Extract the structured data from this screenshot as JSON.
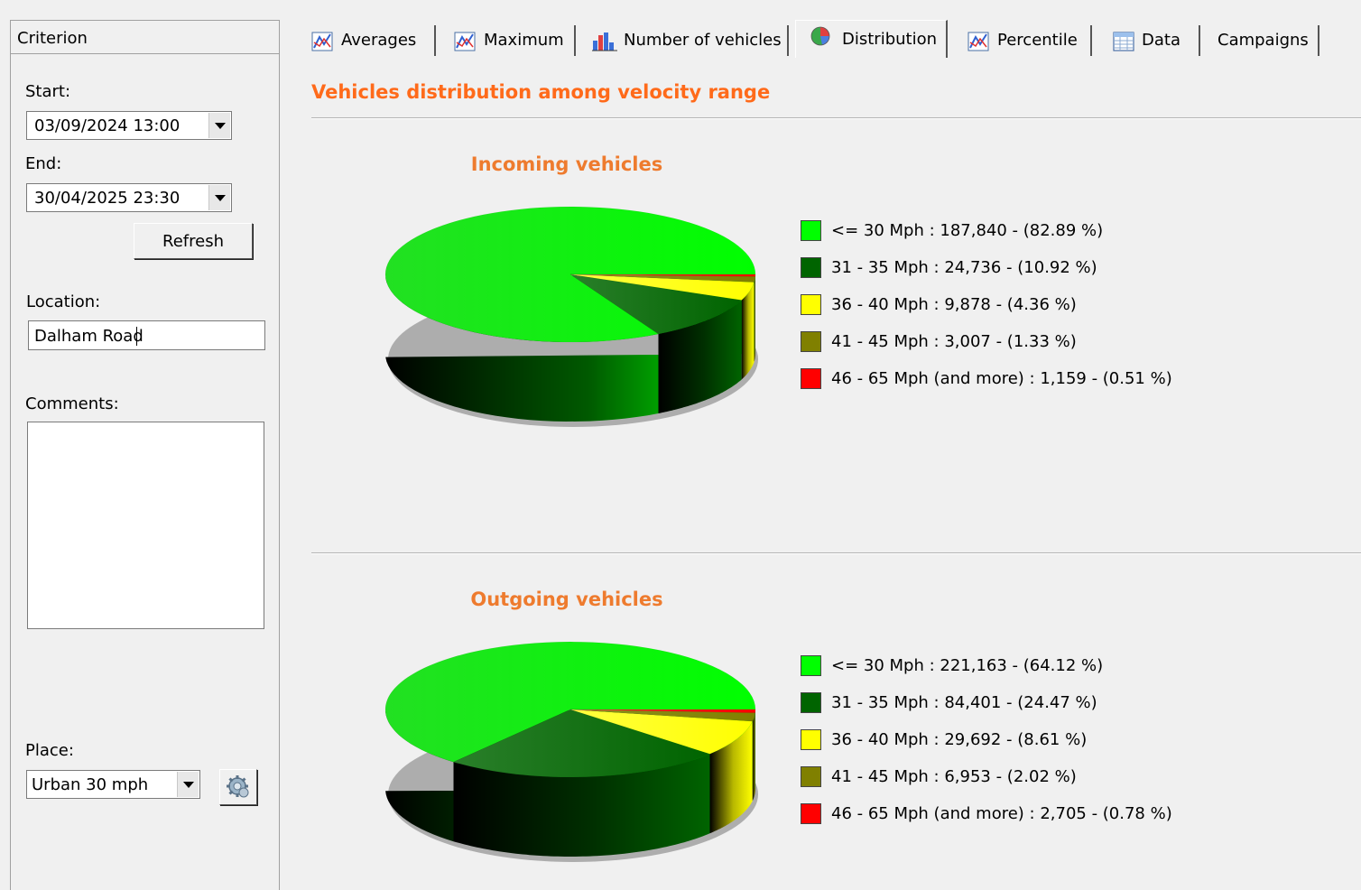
{
  "criterion": {
    "header": "Criterion",
    "start_label": "Start:",
    "start_value": "03/09/2024 13:00",
    "end_label": "End:",
    "end_value": "30/04/2025 23:30",
    "refresh_label": "Refresh",
    "location_label": "Location:",
    "location_value": "Dalham Road",
    "comments_label": "Comments:",
    "comments_value": "",
    "place_label": "Place:",
    "place_value": "Urban 30 mph"
  },
  "tabs": [
    {
      "label": "Averages",
      "icon": "line-chart-icon"
    },
    {
      "label": "Maximum",
      "icon": "line-chart-icon"
    },
    {
      "label": "Number of vehicles",
      "icon": "bar-chart-icon"
    },
    {
      "label": "Distribution",
      "icon": "pie-chart-icon",
      "active": true
    },
    {
      "label": "Percentile",
      "icon": "line-chart-icon"
    },
    {
      "label": "Data",
      "icon": "table-icon"
    },
    {
      "label": "Campaigns",
      "icon": ""
    }
  ],
  "page_title": "Vehicles distribution among velocity range",
  "colors": {
    "title": "#ff6a1a",
    "chart_title": "#ee7b2e",
    "range_1": "#00ff00",
    "range_2": "#006400",
    "range_3": "#ffff00",
    "range_4": "#808000",
    "range_5": "#ff0000"
  },
  "chart_data": [
    {
      "type": "pie",
      "title": "Incoming vehicles",
      "categories": [
        "<=  30 Mph",
        "31 -  35 Mph",
        "36 -  40 Mph",
        "41 -  45 Mph",
        "46 -  65 Mph (and more)"
      ],
      "values": [
        187840,
        24736,
        9878,
        3007,
        1159
      ],
      "percentages": [
        82.89,
        10.92,
        4.36,
        1.33,
        0.51
      ],
      "legend": [
        "<=  30 Mph : 187,840 -  (82.89 %)",
        "31 -  35 Mph : 24,736 -  (10.92 %)",
        "36 -  40 Mph :  9,878 -  (4.36 %)",
        "41 -  45 Mph :  3,007 -  (1.33 %)",
        "46 -  65 Mph (and more) :  1,159 -  (0.51 %)"
      ]
    },
    {
      "type": "pie",
      "title": "Outgoing vehicles",
      "categories": [
        "<=  30 Mph",
        "31 -  35 Mph",
        "36 -  40 Mph",
        "41 -  45 Mph",
        "46 -  65 Mph (and more)"
      ],
      "values": [
        221163,
        84401,
        29692,
        6953,
        2705
      ],
      "percentages": [
        64.12,
        24.47,
        8.61,
        2.02,
        0.78
      ],
      "legend": [
        "<=  30 Mph : 221,163 -  (64.12 %)",
        "31 -  35 Mph : 84,401 -  (24.47 %)",
        "36 -  40 Mph : 29,692 -  (8.61 %)",
        "41 -  45 Mph :  6,953 -  (2.02 %)",
        "46 -  65 Mph (and more) :  2,705 -  (0.78 %)"
      ]
    }
  ]
}
